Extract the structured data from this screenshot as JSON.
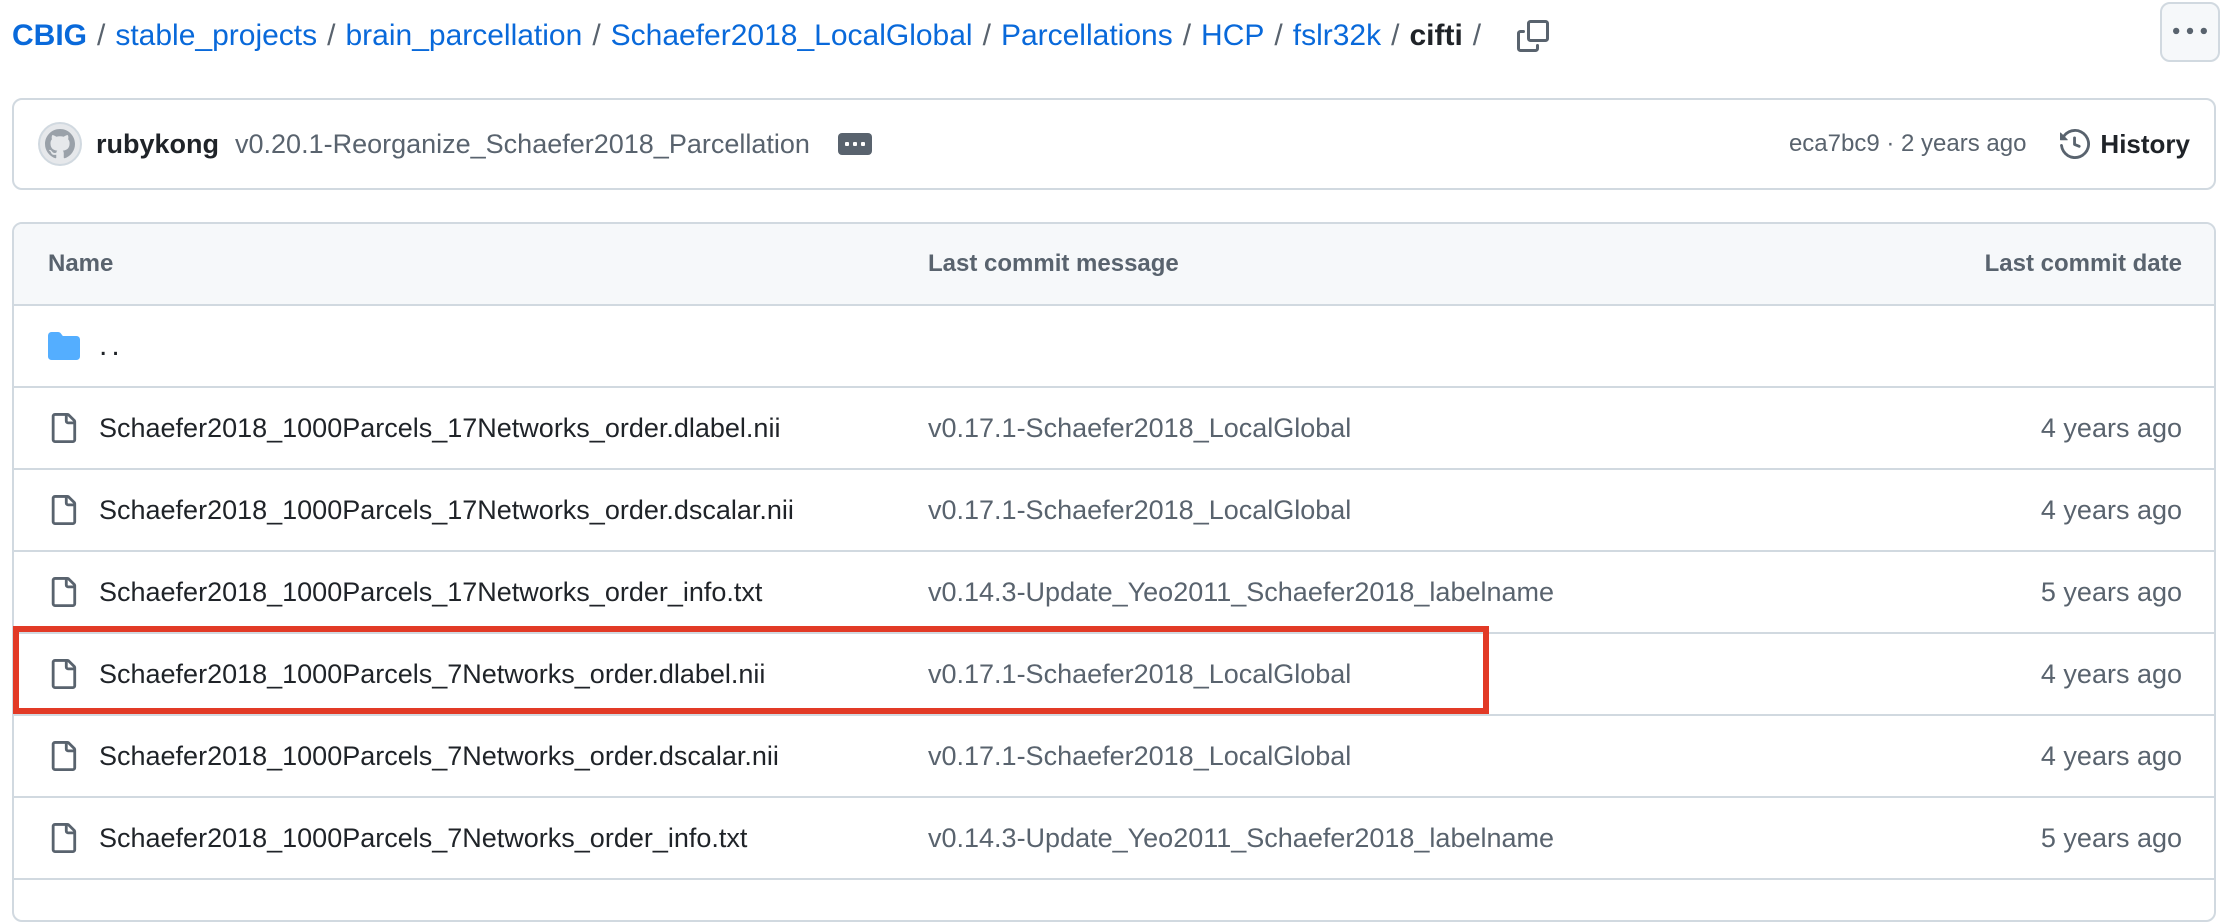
{
  "breadcrumb": {
    "items": [
      "CBIG",
      "stable_projects",
      "brain_parcellation",
      "Schaefer2018_LocalGlobal",
      "Parcellations",
      "HCP",
      "fslr32k"
    ],
    "current": "cifti",
    "separator": "/"
  },
  "commit": {
    "author": "rubykong",
    "message": "v0.20.1-Reorganize_Schaefer2018_Parcellation",
    "meta": "eca7bc9 · 2 years ago",
    "history_label": "History"
  },
  "table": {
    "headers": {
      "name": "Name",
      "message": "Last commit message",
      "date": "Last commit date"
    },
    "parent": "..",
    "rows": [
      {
        "name": "Schaefer2018_1000Parcels_17Networks_order.dlabel.nii",
        "message": "v0.17.1-Schaefer2018_LocalGlobal",
        "date": "4 years ago"
      },
      {
        "name": "Schaefer2018_1000Parcels_17Networks_order.dscalar.nii",
        "message": "v0.17.1-Schaefer2018_LocalGlobal",
        "date": "4 years ago"
      },
      {
        "name": "Schaefer2018_1000Parcels_17Networks_order_info.txt",
        "message": "v0.14.3-Update_Yeo2011_Schaefer2018_labelname",
        "date": "5 years ago"
      },
      {
        "name": "Schaefer2018_1000Parcels_7Networks_order.dlabel.nii",
        "message": "v0.17.1-Schaefer2018_LocalGlobal",
        "date": "4 years ago"
      },
      {
        "name": "Schaefer2018_1000Parcels_7Networks_order.dscalar.nii",
        "message": "v0.17.1-Schaefer2018_LocalGlobal",
        "date": "4 years ago"
      },
      {
        "name": "Schaefer2018_1000Parcels_7Networks_order_info.txt",
        "message": "v0.14.3-Update_Yeo2011_Schaefer2018_labelname",
        "date": "5 years ago"
      }
    ]
  },
  "icons": {
    "copy": "copy-icon",
    "more": "kebab-horizontal-icon",
    "history": "history-clock-icon",
    "folder": "folder-icon",
    "file": "file-icon"
  },
  "colors": {
    "link": "#0969da",
    "muted": "#59636e",
    "border": "#d1d9e0",
    "folder": "#54aeff",
    "highlight": "#e23a26"
  }
}
